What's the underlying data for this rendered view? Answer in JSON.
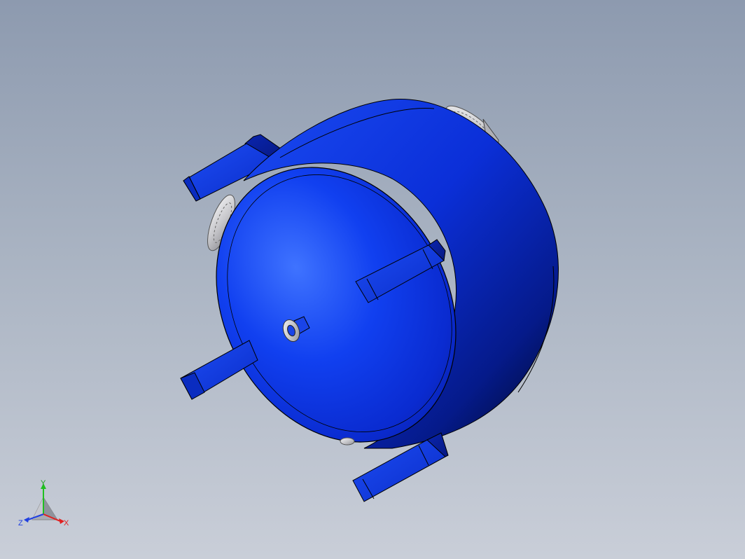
{
  "colors": {
    "background_top": "#8d9aaf",
    "background_bottom": "#c9ced8",
    "vessel": "#0a2fd8",
    "vessel_dark": "#000a3a",
    "flange": "#d8d8dc",
    "axis_x": "#e02020",
    "axis_y": "#20c020",
    "axis_z": "#2040e0"
  },
  "triad": {
    "x_label": "X",
    "y_label": "Y",
    "z_label": "Z"
  }
}
